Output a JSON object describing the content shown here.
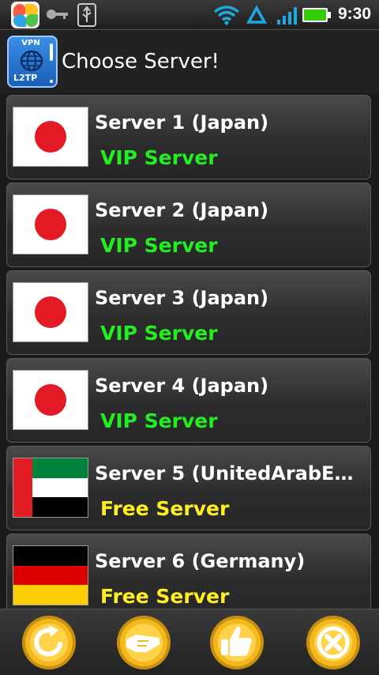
{
  "status_bar": {
    "time": "9:30",
    "icons": [
      "app-store-icon",
      "key-icon",
      "usb-icon",
      "wifi-icon",
      "sync-triangle-icon",
      "signal-icon",
      "battery-icon"
    ],
    "battery_color": "#33cc00",
    "wifi_color": "#1ea8e0"
  },
  "header": {
    "app_icon_top": "VPN",
    "app_icon_bottom": "L2TP",
    "title": "Choose Server!"
  },
  "servers": [
    {
      "name": "Server 1 (Japan)",
      "type": "VIP Server",
      "flag": "japan-flag-icon",
      "type_color": "#22ee22"
    },
    {
      "name": "Server 2 (Japan)",
      "type": "VIP Server",
      "flag": "japan-flag-icon",
      "type_color": "#22ee22"
    },
    {
      "name": "Server 3 (Japan)",
      "type": "VIP Server",
      "flag": "japan-flag-icon",
      "type_color": "#22ee22"
    },
    {
      "name": "Server 4 (Japan)",
      "type": "VIP Server",
      "flag": "japan-flag-icon",
      "type_color": "#22ee22"
    },
    {
      "name": "Server 5 (UnitedArabEm...",
      "type": "Free Server",
      "flag": "uae-flag-icon",
      "type_color": "#ffee22"
    },
    {
      "name": "Server 6 (Germany)",
      "type": "Free Server",
      "flag": "germany-flag-icon",
      "type_color": "#ffee22"
    }
  ],
  "toolbar": {
    "buttons": [
      "refresh-icon",
      "handshake-icon",
      "thumbs-up-icon",
      "close-icon"
    ],
    "button_color": "#f2b81e"
  }
}
